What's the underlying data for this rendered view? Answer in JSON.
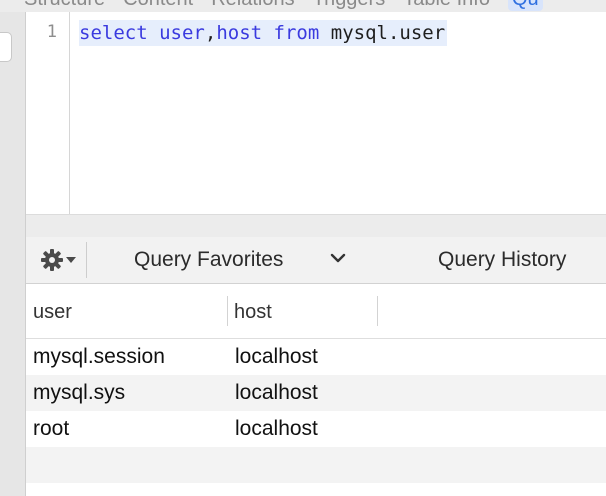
{
  "tabs": [
    "Structure",
    "Content",
    "Relations",
    "Triggers",
    "Table Info",
    "Qu"
  ],
  "editor": {
    "line_number": "1",
    "tokens": {
      "select": "select",
      "user": "user",
      "comma": ",",
      "host": "host",
      "from": "from",
      "table": "mysql.user"
    }
  },
  "toolbar": {
    "gear_icon": "gear-icon",
    "favorites_label": "Query Favorites",
    "history_label": "Query History"
  },
  "results": {
    "columns": [
      "user",
      "host"
    ],
    "rows": [
      [
        "mysql.session",
        "localhost"
      ],
      [
        "mysql.sys",
        "localhost"
      ],
      [
        "root",
        "localhost"
      ]
    ]
  }
}
